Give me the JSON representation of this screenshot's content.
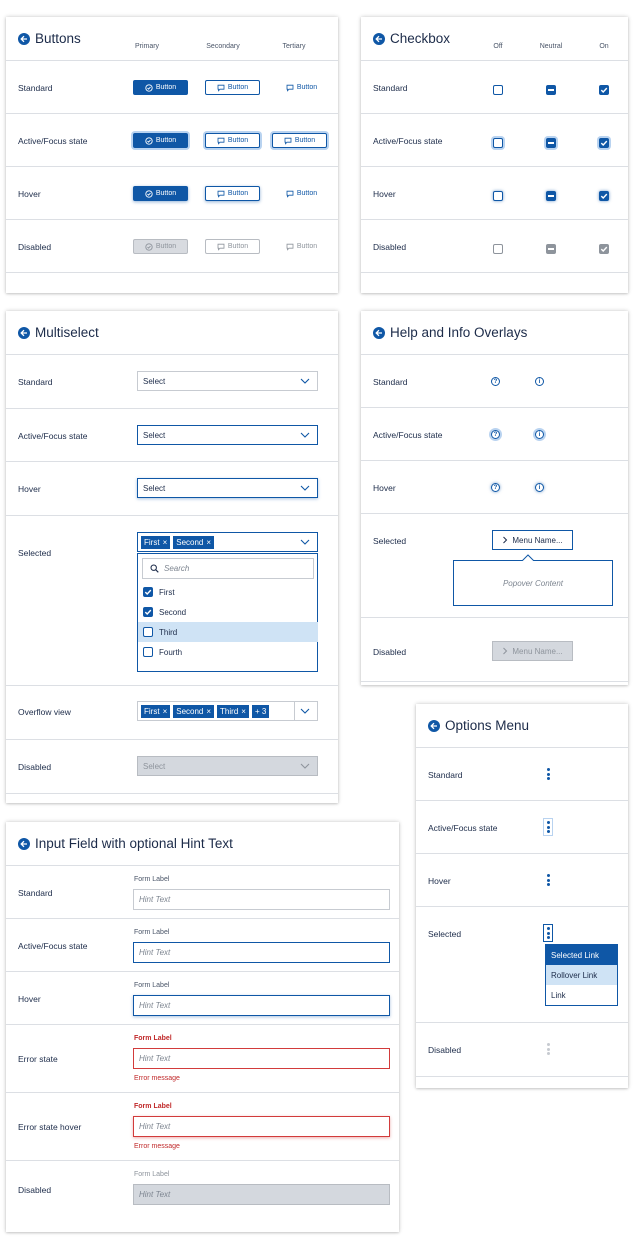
{
  "colors": {
    "accent": "#0f57a6",
    "highlight": "#cfe3f5",
    "error": "#c0292a",
    "disabled": "#d4d8de"
  },
  "buttons": {
    "title": "Buttons",
    "cols": [
      "Primary",
      "Secondary",
      "Tertiary"
    ],
    "rows": [
      "Standard",
      "Active/Focus state",
      "Hover",
      "Disabled"
    ],
    "label": "Button"
  },
  "checkbox": {
    "title": "Checkbox",
    "cols": [
      "Off",
      "Neutral",
      "On"
    ],
    "rows": [
      "Standard",
      "Active/Focus state",
      "Hover",
      "Disabled"
    ]
  },
  "multiselect": {
    "title": "Multiselect",
    "rows": [
      "Standard",
      "Active/Focus state",
      "Hover",
      "Selected",
      "Overflow view",
      "Disabled"
    ],
    "select_placeholder": "Select",
    "chips": [
      "First",
      "Second",
      "Third"
    ],
    "overflow_count": "+ 3",
    "search_placeholder": "Search",
    "options": [
      {
        "label": "First",
        "checked": true
      },
      {
        "label": "Second",
        "checked": true
      },
      {
        "label": "Third",
        "checked": false
      },
      {
        "label": "Fourth",
        "checked": false
      }
    ]
  },
  "help": {
    "title": "Help and Info Overlays",
    "rows": [
      "Standard",
      "Active/Focus state",
      "Hover",
      "Selected",
      "Disabled"
    ],
    "help_glyph": "?",
    "info_glyph": "i",
    "menu_label": "Menu Name...",
    "popover": "Popover Content"
  },
  "options_menu": {
    "title": "Options Menu",
    "rows": [
      "Standard",
      "Active/Focus state",
      "Hover",
      "Selected",
      "Disabled"
    ],
    "items": [
      "Selected Link",
      "Rollover Link",
      "Link"
    ]
  },
  "input_field": {
    "title": "Input Field with optional Hint Text",
    "rows": [
      "Standard",
      "Active/Focus state",
      "Hover",
      "Error state",
      "Error state hover",
      "Disabled"
    ],
    "form_label": "Form Label",
    "hint": "Hint Text",
    "error_message": "Error message"
  }
}
